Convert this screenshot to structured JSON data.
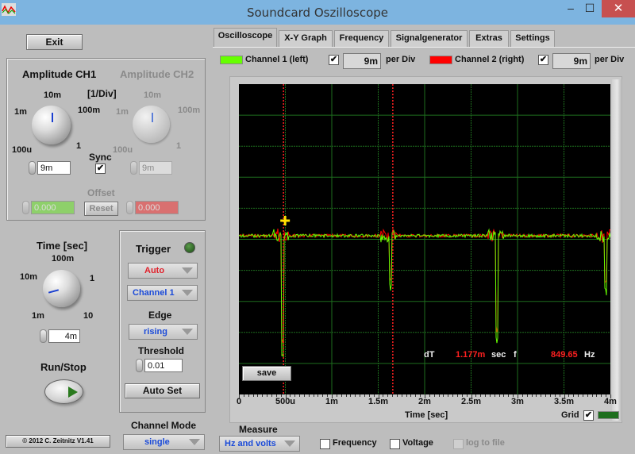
{
  "window": {
    "title": "Soundcard Oszilloscope",
    "minimize": "–",
    "maximize": "☐",
    "close": "✕"
  },
  "left": {
    "exit_label": "Exit",
    "amp_ch1_title": "Amplitude CH1",
    "amp_ch2_title": "Amplitude CH2",
    "div_unit": "[1/Div]",
    "knob_ticks": {
      "t10m": "10m",
      "t1m": "1m",
      "t100m": "100m",
      "t100u": "100u",
      "t1": "1"
    },
    "ch1_value": "9m",
    "ch2_value": "9m",
    "sync_label": "Sync",
    "sync_checked": "✔",
    "offset_label": "Offset",
    "offset_ch1": "0.000",
    "offset_ch2": "0.000",
    "reset_label": "Reset",
    "time_title": "Time [sec]",
    "time_ticks": {
      "t100m": "100m",
      "t10m": "10m",
      "t1": "1",
      "t1m": "1m",
      "t10": "10"
    },
    "time_value": "4m",
    "runstop_label": "Run/Stop",
    "copyright": "© 2012  C. Zeitnitz V1.41",
    "trigger": {
      "title": "Trigger",
      "mode": "Auto",
      "channel": "Channel 1",
      "edge_label": "Edge",
      "edge": "rising",
      "threshold_label": "Threshold",
      "threshold": "0.01",
      "autoset_label": "Auto Set"
    },
    "channel_mode_label": "Channel Mode",
    "channel_mode": "single"
  },
  "tabs": [
    "Oscilloscope",
    "X-Y Graph",
    "Frequency",
    "Signalgenerator",
    "Extras",
    "Settings"
  ],
  "channels": {
    "ch1_label": "Channel 1 (left)",
    "ch1_color": "#66ff00",
    "ch1_checked": "✔",
    "ch1_perdiv": "9m",
    "ch2_label": "Channel 2 (right)",
    "ch2_color": "#ff0000",
    "ch2_checked": "✔",
    "ch2_perdiv": "9m",
    "per_div": "per Div"
  },
  "plot": {
    "save_label": "save",
    "dt_label": "dT",
    "dt_value": "1.177m",
    "dt_unit": "sec",
    "f_label": "f",
    "f_value": "849.65",
    "f_unit": "Hz",
    "xlabel": "Time [sec]",
    "xticks": [
      "0",
      "500u",
      "1m",
      "1.5m",
      "2m",
      "2.5m",
      "3m",
      "3.5m",
      "4m"
    ],
    "grid_label": "Grid",
    "grid_checked": "✔",
    "grid_color": "#1e6e1e",
    "cursor_times_ms": [
      0.48,
      1.657
    ],
    "spike_times_ms": [
      0.47,
      1.63,
      2.78,
      3.95
    ]
  },
  "measure": {
    "title": "Measure",
    "mode": "Hz and volts",
    "frequency_label": "Frequency",
    "voltage_label": "Voltage",
    "log_label": "log to file"
  }
}
